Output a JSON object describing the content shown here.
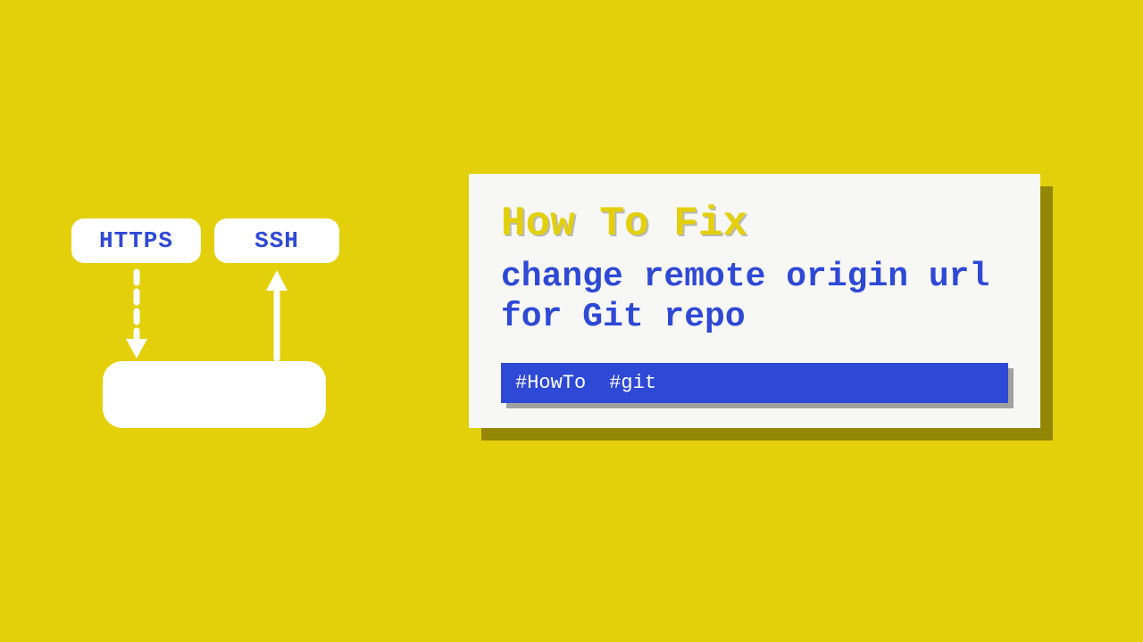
{
  "diagram": {
    "https_label": "HTTPS",
    "ssh_label": "SSH"
  },
  "card": {
    "title": "How To Fix",
    "subtitle": "change remote origin url for Git repo",
    "tags": {
      "tag1": "#HowTo",
      "tag2": "#git"
    }
  }
}
